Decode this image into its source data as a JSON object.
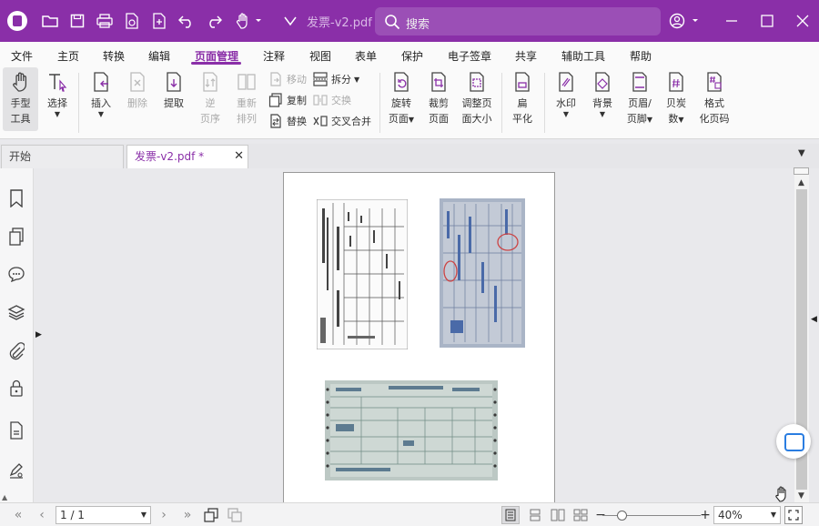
{
  "titlebar": {
    "document_title": "发票-v2.pdf ...",
    "search_placeholder": "搜索",
    "brand_color": "#8a2fa8"
  },
  "menu": [
    "文件",
    "主页",
    "转换",
    "编辑",
    "页面管理",
    "注释",
    "视图",
    "表单",
    "保护",
    "电子签章",
    "共享",
    "辅助工具",
    "帮助"
  ],
  "menu_active": "页面管理",
  "ribbon": {
    "hand_tool": [
      "手型",
      "工具"
    ],
    "select": "选择",
    "insert": "插入",
    "delete": "删除",
    "extract": "提取",
    "reverse": [
      "逆",
      "页序"
    ],
    "rearrange": [
      "重新",
      "排列"
    ],
    "move": "移动",
    "copy": "复制",
    "replace": "替换",
    "split": "拆分",
    "swap": "交换",
    "interleave": "交叉合并",
    "rotate": [
      "旋转",
      "页面"
    ],
    "crop": [
      "裁剪",
      "页面"
    ],
    "resize": [
      "调整页",
      "面大小"
    ],
    "flatten": [
      "扁",
      "平化"
    ],
    "watermark": "水印",
    "background": "背景",
    "header_footer": [
      "页眉/",
      "页脚"
    ],
    "page_number": [
      "贝炭",
      "数"
    ],
    "format_page_number": [
      "格式",
      "化页码"
    ]
  },
  "tabs": {
    "start": "开始",
    "document": "发票-v2.pdf *"
  },
  "status": {
    "page_indicator": "1 / 1",
    "zoom": "40%"
  }
}
